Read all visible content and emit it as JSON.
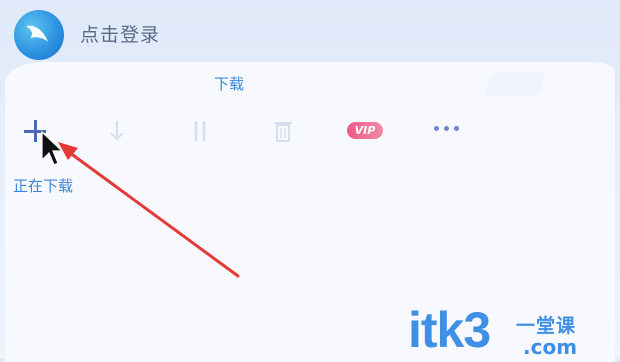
{
  "header": {
    "login_label": "点击登录",
    "logo_icon": "bird-logo-icon"
  },
  "tab": {
    "title": "下载"
  },
  "toolbar": {
    "new_task_icon": "plus-icon",
    "start_icon": "download-arrow-icon",
    "pause_icon": "pause-icon",
    "delete_icon": "trash-icon",
    "vip_label": "VIP",
    "more_icon": "more-dots-icon"
  },
  "section": {
    "downloading_label": "正在下载"
  },
  "watermark": {
    "text": "itk3",
    "top": "一堂课",
    "bottom": ".com"
  },
  "colors": {
    "accent": "#3b86d8",
    "vip": "#ee5a86",
    "annotation_arrow": "#e53935"
  }
}
